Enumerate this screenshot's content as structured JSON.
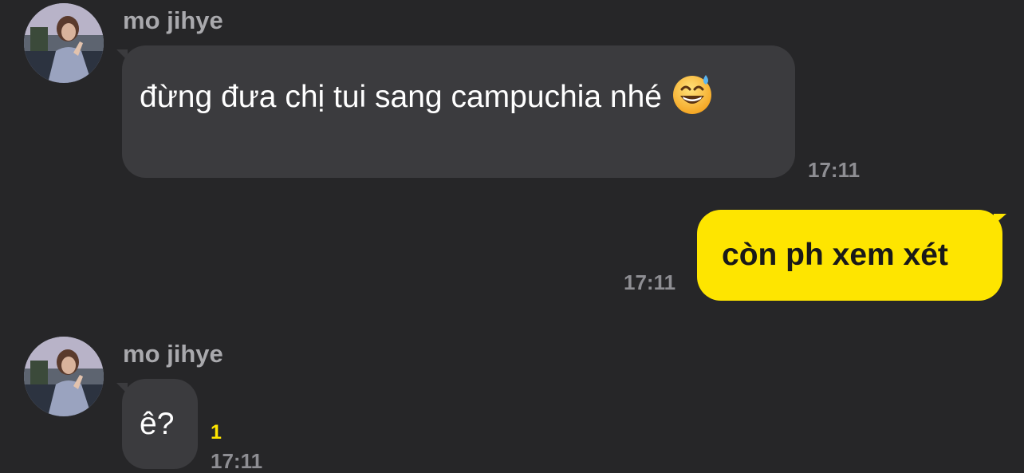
{
  "messages": [
    {
      "sender": "mo jihye",
      "text": "đừng đưa chị tui sang campuchia nhé",
      "emoji_icon": "grinning-face-with-sweat-emoji",
      "time": "17:11"
    },
    {
      "sender": "me",
      "text": "còn ph xem xét",
      "time": "17:11"
    },
    {
      "sender": "mo jihye",
      "text": "ê?",
      "unread_count": "1",
      "time": "17:11"
    }
  ],
  "colors": {
    "background": "#262628",
    "incoming_bubble": "#3b3b3e",
    "outgoing_bubble": "#fee500",
    "unread_count": "#fee500"
  }
}
